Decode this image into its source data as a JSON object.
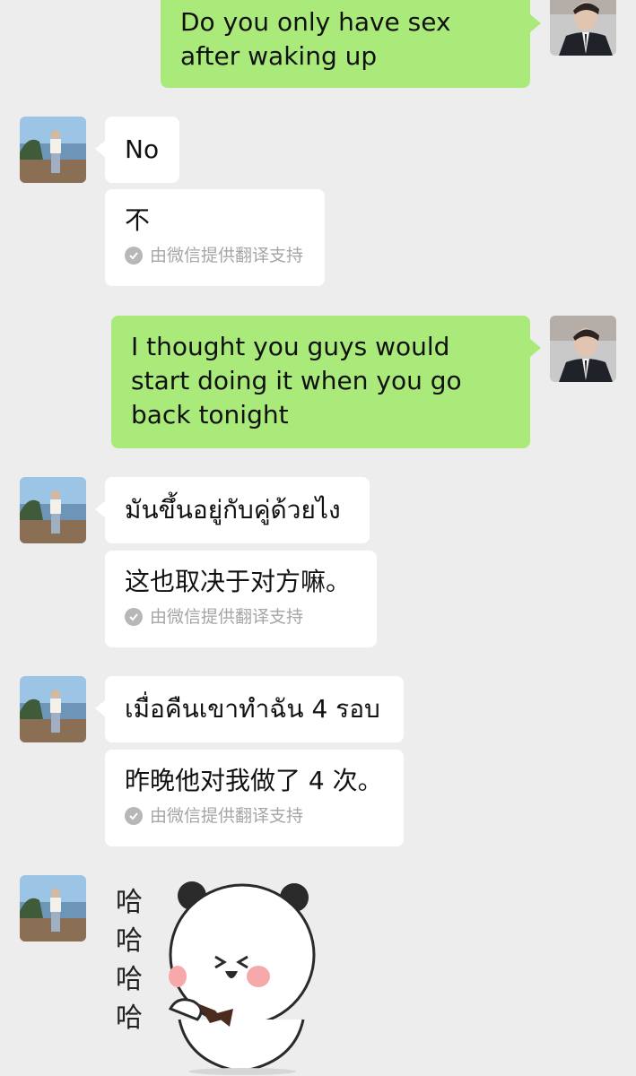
{
  "messages": [
    {
      "side": "right",
      "text": "Do you only have sex after waking up"
    },
    {
      "side": "left",
      "text": "No",
      "translation": "不",
      "translation_note": "由微信提供翻译支持"
    },
    {
      "side": "right",
      "text": "I thought you guys would start doing it when you go back tonight"
    },
    {
      "side": "left",
      "text": "มันขึ้นอยู่กับคู่ด้วยไง",
      "translation": "这也取决于对方嘛。",
      "translation_note": "由微信提供翻译支持"
    },
    {
      "side": "left",
      "text": "เมื่อคืนเขาทำฉัน 4 รอบ",
      "translation": "昨晚他对我做了 4 次。",
      "translation_note": "由微信提供翻译支持"
    },
    {
      "side": "left",
      "sticker": "panda-laughing-sticker",
      "sticker_text": [
        "哈",
        "哈",
        "哈",
        "哈"
      ]
    }
  ],
  "colors": {
    "background": "#ededed",
    "sent_bubble": "#a9ea7a",
    "received_bubble": "#ffffff",
    "note_text": "#a5a5a5"
  }
}
